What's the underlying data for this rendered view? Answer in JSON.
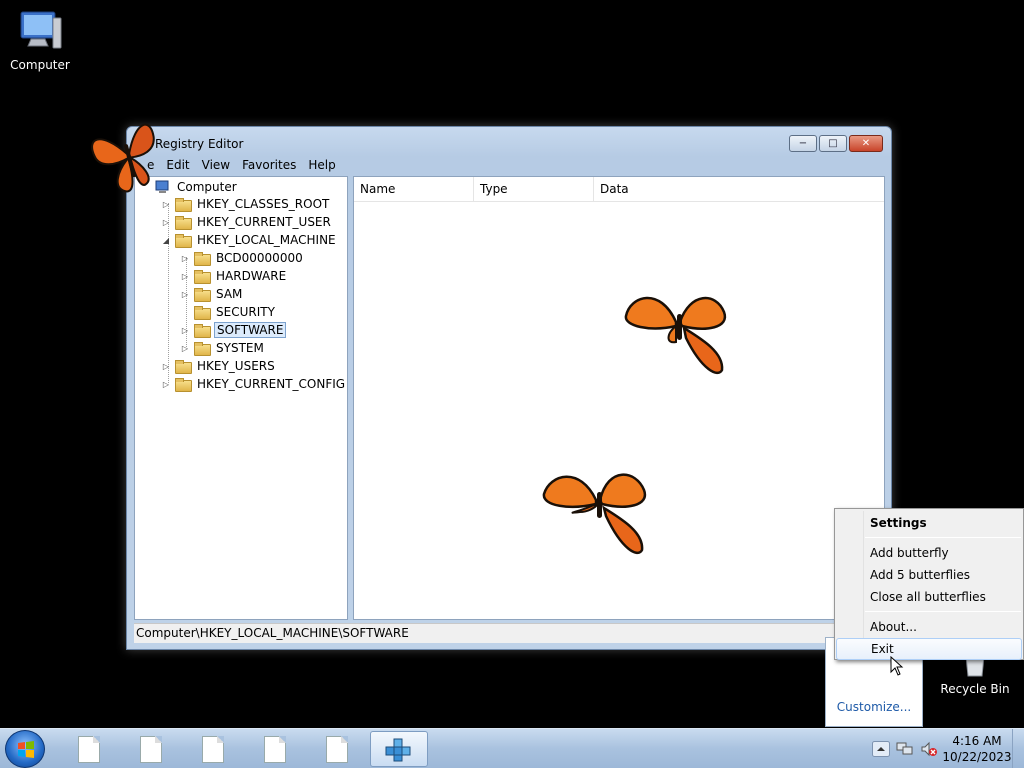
{
  "desktop": {
    "computer_label": "Computer",
    "recycle_label": "Recycle Bin"
  },
  "window": {
    "title": "Registry Editor",
    "minimize": "−",
    "maximize": "□",
    "close": "✕",
    "menu": [
      "File",
      "Edit",
      "View",
      "Favorites",
      "Help"
    ],
    "menu_visible": [
      "e",
      "Edit",
      "View",
      "Favorites",
      "Help"
    ],
    "tree": {
      "root": "Computer",
      "items": [
        {
          "label": "HKEY_CLASSES_ROOT",
          "expander": "▷"
        },
        {
          "label": "HKEY_CURRENT_USER",
          "expander": "▷"
        },
        {
          "label": "HKEY_LOCAL_MACHINE",
          "expander": "◢"
        },
        {
          "label": "BCD00000000",
          "expander": "▷"
        },
        {
          "label": "HARDWARE",
          "expander": "▷"
        },
        {
          "label": "SAM",
          "expander": "▷"
        },
        {
          "label": "SECURITY",
          "expander": ""
        },
        {
          "label": "SOFTWARE",
          "expander": "▷"
        },
        {
          "label": "SYSTEM",
          "expander": "▷"
        },
        {
          "label": "HKEY_USERS",
          "expander": "▷"
        },
        {
          "label": "HKEY_CURRENT_CONFIG",
          "expander": "▷"
        }
      ]
    },
    "columns": [
      "Name",
      "Type",
      "Data"
    ],
    "status_path": "Computer\\HKEY_LOCAL_MACHINE\\SOFTWARE"
  },
  "context_menu": {
    "title": "Settings",
    "items": [
      "Add butterfly",
      "Add 5 butterflies",
      "Close all butterflies",
      "About...",
      "Exit"
    ]
  },
  "tray_overflow": {
    "customize": "Customize..."
  },
  "taskbar": {
    "time": "4:16 AM",
    "date": "10/22/2023"
  },
  "colors": {
    "butterfly_orange": "#e8661a",
    "butterfly_black": "#1a1008",
    "taskbar": "#a9c2df"
  }
}
